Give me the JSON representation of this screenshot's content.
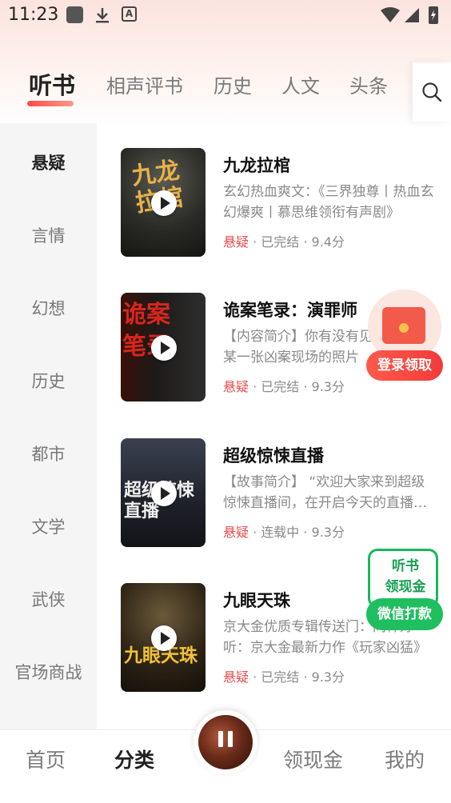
{
  "status_bar": {
    "time": "11:23"
  },
  "top_tabs": [
    {
      "label": "听书"
    },
    {
      "label": "相声评书"
    },
    {
      "label": "历史"
    },
    {
      "label": "人文"
    },
    {
      "label": "头条"
    }
  ],
  "sidebar": {
    "items": [
      {
        "label": "悬疑"
      },
      {
        "label": "言情"
      },
      {
        "label": "幻想"
      },
      {
        "label": "历史"
      },
      {
        "label": "都市"
      },
      {
        "label": "文学"
      },
      {
        "label": "武侠"
      },
      {
        "label": "官场商战"
      }
    ]
  },
  "books": [
    {
      "title": "九龙拉棺",
      "desc": "玄幻热血爽文：《三界独尊丨热血玄幻爆爽丨慕思维领衔有声剧》",
      "genre": "悬疑",
      "status": "· 已完结 · 9.4分",
      "cover_text": "九龙拉棺"
    },
    {
      "title": "诡案笔录：演罪师",
      "desc": "【内容简介】你有没有见过，看见某一张凶案现场的照片",
      "genre": "悬疑",
      "status": "· 已完结 · 9.3分",
      "cover_text": "诡案笔录"
    },
    {
      "title": "超级惊悚直播",
      "desc": "【故事简介】 “欢迎大家来到超级惊悚直播间，在开启今天的直播之前",
      "genre": "悬疑",
      "status": "· 连载中 · 9.3分",
      "cover_text": "超级惊悚直播"
    },
    {
      "title": "九眼天珠",
      "desc": "京大金优质专辑传送门：同样好听：京大金最新力作《玩家凶猛》",
      "genre": "悬疑",
      "status": "· 已完结 · 9.3分",
      "cover_text": "九眼天珠"
    }
  ],
  "redpack": {
    "label": "登录领取"
  },
  "wechat": {
    "line1": "听书",
    "line2": "领现金",
    "label": "微信打款"
  },
  "bottom_nav": [
    {
      "label": "首页"
    },
    {
      "label": "分类"
    },
    {
      "label": "领现金"
    },
    {
      "label": "我的"
    }
  ],
  "colors": {
    "accent_red": "#e84c4c",
    "wechat_green": "#1fbf5f"
  }
}
